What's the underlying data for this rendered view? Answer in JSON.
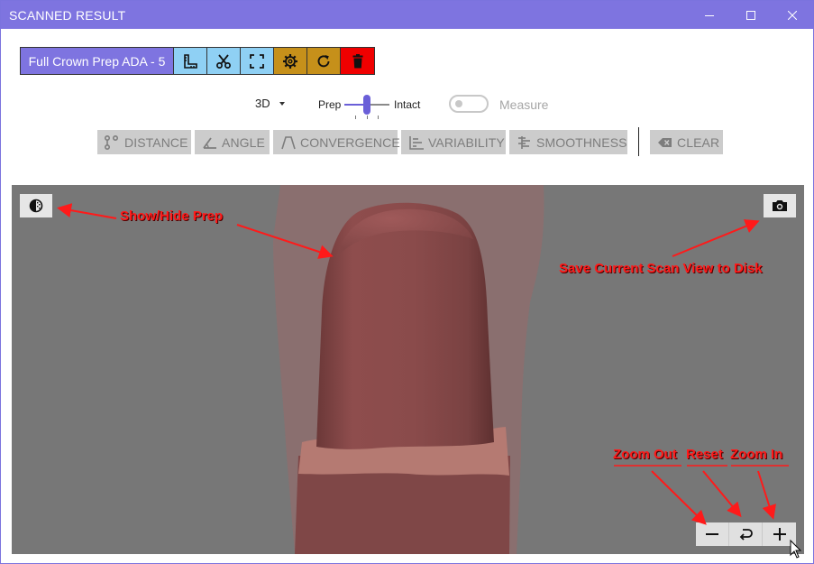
{
  "window": {
    "title": "SCANNED RESULT"
  },
  "toolbar": {
    "case_label": "Full Crown Prep ADA - 5",
    "buttons": [
      {
        "icon": "ruler-icon",
        "color": "#8fd0f4"
      },
      {
        "icon": "scissors-icon",
        "color": "#8fd0f4"
      },
      {
        "icon": "crop-frame-icon",
        "color": "#8fd0f4"
      },
      {
        "icon": "gear-icon",
        "color": "#c6901a"
      },
      {
        "icon": "refresh-icon",
        "color": "#c6901a"
      },
      {
        "icon": "trash-icon",
        "color": "#f00000"
      }
    ]
  },
  "view": {
    "mode": "3D"
  },
  "slider": {
    "left_label": "Prep",
    "right_label": "Intact",
    "value": 0.5
  },
  "measure": {
    "label": "Measure",
    "enabled": false
  },
  "measure_tools": {
    "distance": "DISTANCE",
    "angle": "ANGLE",
    "convergence": "CONVERGENCE",
    "variability": "VARIABILITY",
    "smoothness": "SMOOTHNESS",
    "clear": "CLEAR"
  },
  "annotations": {
    "show_hide": "Show/Hide Prep",
    "save_view": "Save Current Scan View to Disk",
    "zoom_out": "Zoom Out",
    "reset": "Reset",
    "zoom_in": "Zoom In"
  },
  "colors": {
    "accent": "#7e74e0",
    "annotation": "#ff1a1a",
    "viewport_bg": "#777777",
    "tooth": "#a35f5f"
  }
}
